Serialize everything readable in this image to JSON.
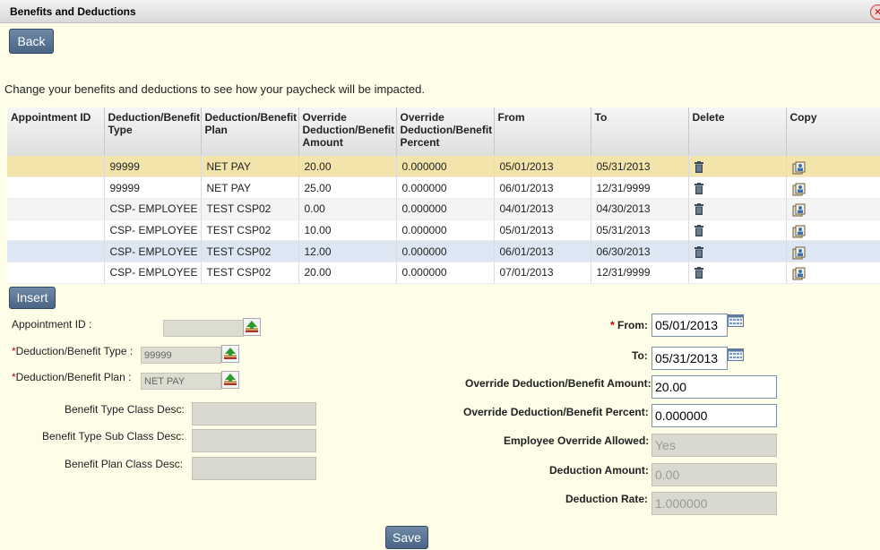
{
  "window": {
    "title": "Benefits and Deductions",
    "close_label": "×"
  },
  "buttons": {
    "back": "Back",
    "insert": "Insert",
    "save": "Save"
  },
  "intro": "Change your benefits and deductions to see how your paycheck will be impacted.",
  "grid": {
    "headers": [
      "Appointment ID",
      "Deduction/Benefit Type",
      "Deduction/Benefit Plan",
      "Override Deduction/Benefit Amount",
      "Override Deduction/Benefit Percent",
      "From",
      "To",
      "Delete",
      "Copy"
    ],
    "rows": [
      {
        "appointment_id": "",
        "type": "99999",
        "plan": "NET PAY",
        "amount": "20.00",
        "percent": "0.000000",
        "from": "05/01/2013",
        "to": "05/31/2013"
      },
      {
        "appointment_id": "",
        "type": "99999",
        "plan": "NET PAY",
        "amount": "25.00",
        "percent": "0.000000",
        "from": "06/01/2013",
        "to": "12/31/9999"
      },
      {
        "appointment_id": "",
        "type": "CSP- EMPLOYEE",
        "plan": "TEST CSP02",
        "amount": "0.00",
        "percent": "0.000000",
        "from": "04/01/2013",
        "to": "04/30/2013"
      },
      {
        "appointment_id": "",
        "type": "CSP- EMPLOYEE",
        "plan": "TEST CSP02",
        "amount": "10.00",
        "percent": "0.000000",
        "from": "05/01/2013",
        "to": "05/31/2013"
      },
      {
        "appointment_id": "",
        "type": "CSP- EMPLOYEE",
        "plan": "TEST CSP02",
        "amount": "12.00",
        "percent": "0.000000",
        "from": "06/01/2013",
        "to": "06/30/2013"
      },
      {
        "appointment_id": "",
        "type": "CSP- EMPLOYEE",
        "plan": "TEST CSP02",
        "amount": "20.00",
        "percent": "0.000000",
        "from": "07/01/2013",
        "to": "12/31/9999"
      }
    ],
    "delete_icon": "trash-icon",
    "copy_icon": "copy-record-icon"
  },
  "form": {
    "appointment_id_label": "Appointment ID :",
    "appointment_id_value": "",
    "type_label": "Deduction/Benefit Type :",
    "type_value": "99999",
    "plan_label": "Deduction/Benefit Plan :",
    "plan_value": "NET PAY",
    "required_mark": "*",
    "benefit_type_class_label": "Benefit Type Class Desc:",
    "benefit_type_sub_class_label": "Benefit Type Sub Class Desc:",
    "benefit_plan_class_label": "Benefit Plan Class Desc:",
    "from_label": "From:",
    "from_value": "05/01/2013",
    "to_label": "To:",
    "to_value": "05/31/2013",
    "override_amount_label": "Override Deduction/Benefit Amount:",
    "override_amount_value": "20.00",
    "override_percent_label": "Override Deduction/Benefit Percent:",
    "override_percent_value": "0.000000",
    "employee_override_label": "Employee Override Allowed:",
    "employee_override_value": "Yes",
    "deduction_amount_label": "Deduction Amount:",
    "deduction_amount_value": "0.00",
    "deduction_rate_label": "Deduction Rate:",
    "deduction_rate_value": "1.000000"
  },
  "colors": {
    "accent_button": "#4a6585",
    "selected_row": "#f3e4ab",
    "hover_row": "#dde7f3",
    "page_bg": "#fdfde8",
    "required": "#c00000"
  }
}
